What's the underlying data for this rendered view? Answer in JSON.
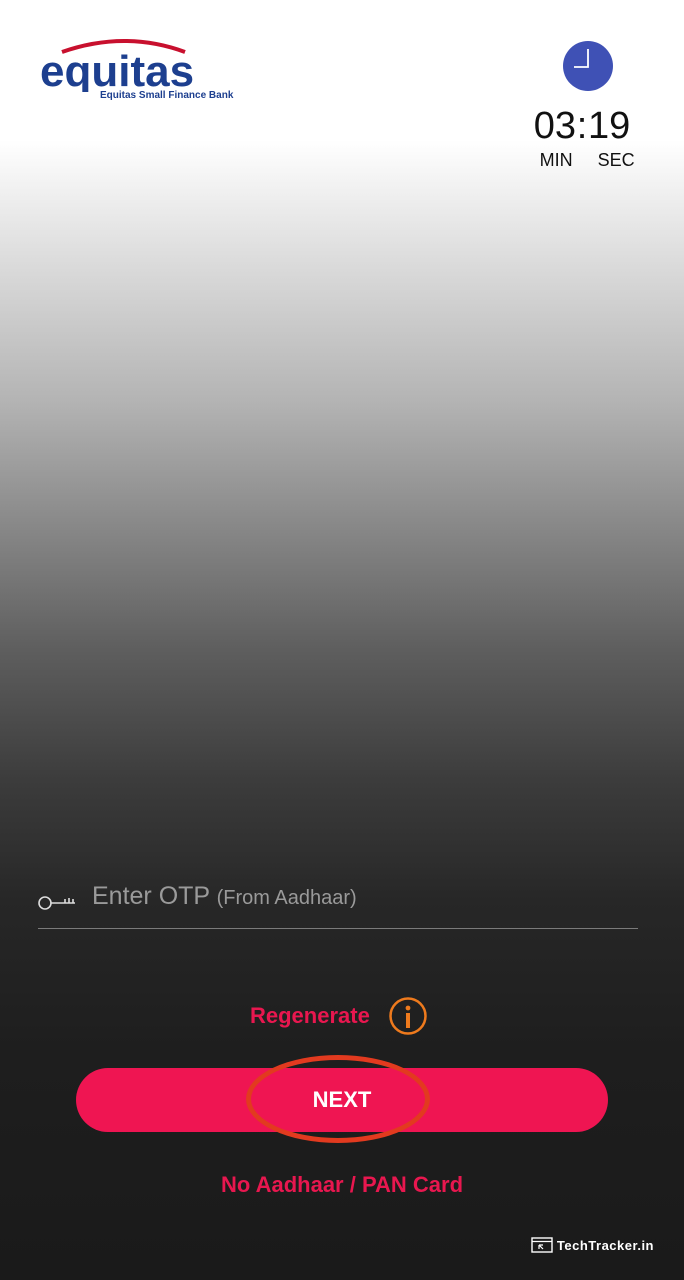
{
  "header": {
    "logo_wordmark": "equitas",
    "logo_subtitle": "Equitas Small Finance Bank",
    "icon": "clock-icon"
  },
  "timer": {
    "minutes": "03",
    "separator": ":",
    "seconds": "19",
    "min_label": "MIN",
    "sec_label": "SEC"
  },
  "otp": {
    "icon": "key-icon",
    "placeholder": "Enter OTP",
    "placeholder_sub": "(From Aadhaar)",
    "value": ""
  },
  "actions": {
    "regenerate_label": "Regenerate",
    "info_icon": "info-icon",
    "next_label": "NEXT",
    "alt_label": "No Aadhaar / PAN Card"
  },
  "watermark": {
    "text": "TechTracker.in"
  },
  "colors": {
    "brand_blue": "#1d3f8f",
    "brand_red": "#c8102e",
    "accent": "#ef1552",
    "link": "#e8174f",
    "info": "#ee7a1d",
    "highlight": "#e23a1f",
    "clock": "#3f51b5"
  }
}
